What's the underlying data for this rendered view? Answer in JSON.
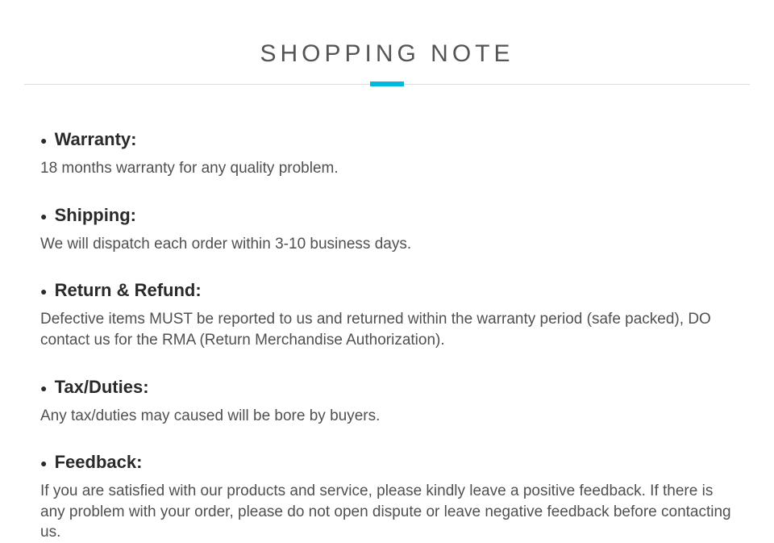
{
  "header": {
    "title": "SHOPPING NOTE"
  },
  "notes": {
    "warranty": {
      "heading": "Warranty:",
      "body": "18 months warranty for any quality problem."
    },
    "shipping": {
      "heading": "Shipping:",
      "body": "We will dispatch each order within 3-10 business days."
    },
    "return": {
      "heading": "Return & Refund:",
      "body": "Defective items MUST be reported to us and  returned within the warranty period (safe packed), DO contact us for the RMA (Return Merchandise Authorization)."
    },
    "tax": {
      "heading": "Tax/Duties:",
      "body": "Any tax/duties may caused will be bore by buyers."
    },
    "feedback": {
      "heading": "Feedback:",
      "body": "If you are satisfied with our products and service, please kindly leave a positive feedback. If there is any problem with your order, please do not open dispute or leave negative feedback before contacting us."
    }
  }
}
